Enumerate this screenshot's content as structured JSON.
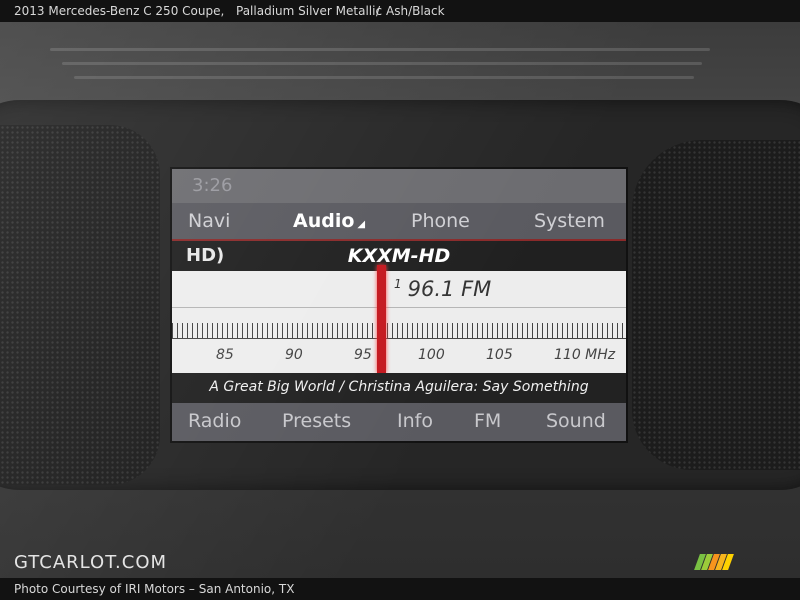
{
  "caption": {
    "title": "2013 Mercedes-Benz C 250 Coupe,",
    "color": "Palladium Silver Metallic",
    "separator": "/",
    "interior": "Ash/Black"
  },
  "footer": {
    "credit": "Photo Courtesy of IRI Motors – San Antonio, TX",
    "logo": "GTCARLOT.COM"
  },
  "screen": {
    "clock": "3:26",
    "menu": [
      {
        "label": "Navi",
        "active": false
      },
      {
        "label": "Audio",
        "active": true
      },
      {
        "label": "Phone",
        "active": false
      },
      {
        "label": "System",
        "active": false
      }
    ],
    "hd_icon": "HD",
    "station": "KXXM-HD",
    "frequency_preset": "1",
    "frequency": "96.1 FM",
    "scale": [
      "85",
      "90",
      "95",
      "100",
      "105",
      "110 MHz"
    ],
    "now_playing": "A Great Big World / Christina Aguilera: Say Something",
    "bottom_menu": [
      "Radio",
      "Presets",
      "Info",
      "FM",
      "Sound"
    ]
  },
  "colors": {
    "needle": "#c4181f",
    "logo_stripes": [
      "#7ac143",
      "#9ccc3a",
      "#f7941d",
      "#f7b51d",
      "#ffd200"
    ]
  }
}
